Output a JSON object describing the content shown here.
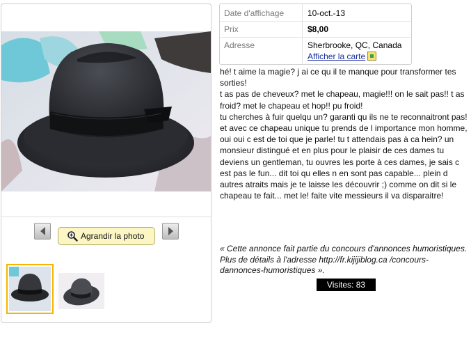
{
  "listing": {
    "date_label": "Date d'affichage",
    "date_value": "10-oct.-13",
    "price_label": "Prix",
    "price_value": "$8,00",
    "address_label": "Adresse",
    "address_value": "Sherbrooke, QC, Canada",
    "map_link_label": "Afficher la carte",
    "map_icon": "map-icon"
  },
  "gallery": {
    "enlarge_label": "Agrandir la photo",
    "enlarge_icon": "magnify-icon",
    "prev_icon": "chevron-left-icon",
    "next_icon": "chevron-right-icon",
    "thumbnails": [
      "hat-photo-1",
      "hat-photo-2"
    ],
    "selected_thumbnail": 1
  },
  "description": {
    "paragraphs": [
      "hé! t aime la magie? j ai ce qu il te manque pour transformer tes sorties!",
      " t as pas de cheveux? met le chapeau, magie!!! on le sait pas!! t as froid?   met le chapeau et hop!! pu froid!",
      " tu cherches à fuir quelqu un?  garanti qu ils ne te reconnaitront pas!",
      " et avec ce chapeau unique tu prends de l importance mon homme,",
      "oui oui c est de toi que je parle! tu t attendais pas à ca hein? un monsieur distingué et en plus pour le plaisir de ces dames tu deviens un gentleman, tu ouvres les porte à ces dames, je sais c est pas le fun... dit toi qu elles n en sont pas capable... plein d autres atraits mais je te laisse les découvrir ;)   comme on dit si le chapeau te fait... met le!   faite vite messieurs  il va disparaitre!"
    ],
    "footnote": "« Cette annonce fait partie du concours d'annonces humoristiques. Plus de détails à l'adresse http://fr.kijijiblog.ca /concours-dannonces-humoristiques »."
  },
  "stats": {
    "visits_label": "Visites: 83"
  },
  "colors": {
    "link": "#1a2ea0",
    "thumb_selected_border": "#f4b400",
    "enlarge_button_bg": "#fbf6c4",
    "visits_bg": "#000000"
  }
}
